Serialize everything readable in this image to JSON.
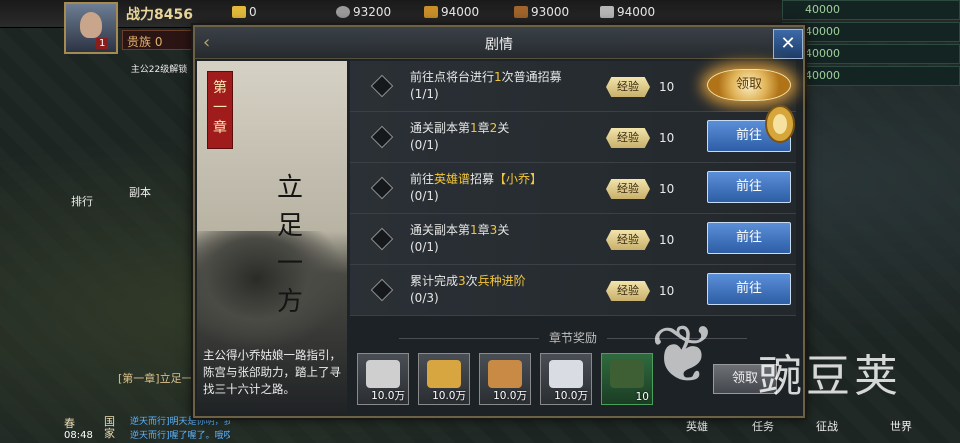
{
  "hud": {
    "power": "战力8456",
    "level": "1",
    "noble": "贵族  0",
    "resources": [
      {
        "name": "gold",
        "value": "0",
        "color": "#e2b93b"
      },
      {
        "name": "coin",
        "value": "93200",
        "color": "#9c9c9c"
      },
      {
        "name": "grain",
        "value": "94000",
        "color": "#c98f2a"
      },
      {
        "name": "wood",
        "value": "93000",
        "color": "#a0642c"
      },
      {
        "name": "iron",
        "value": "94000",
        "color": "#b7b7b7"
      }
    ],
    "right_stats": [
      "40000",
      "40000",
      "40000",
      "40000"
    ],
    "left_menu": [
      "主公22级解锁",
      "副本",
      "排行"
    ],
    "bottom": {
      "chapter_hint": "[第一章]立足一",
      "season": "春",
      "time": "08:48",
      "country": "国家",
      "chat": [
        "逆天而行]明天是你明，我大我天的",
        "逆天而行]喔了喔了。哦哎"
      ],
      "buttons": [
        "英雄",
        "任务",
        "征战",
        "世界"
      ]
    }
  },
  "dialog": {
    "title": "剧情",
    "chapter": {
      "tag": "第一章",
      "title": "立足一方",
      "description": "主公得小乔姑娘一路指引，陈宫与张郃助力，踏上了寻找三十六计之路。"
    },
    "quests": [
      {
        "title_parts": [
          [
            "前往点将台进行",
            ""
          ],
          [
            "1",
            "hl"
          ],
          [
            "次普通招募",
            ""
          ]
        ],
        "progress": "(1/1)",
        "exp_label": "经验",
        "exp": "10",
        "button": "领取",
        "state": "claim"
      },
      {
        "title_parts": [
          [
            "通关副本第",
            ""
          ],
          [
            "1",
            "hl"
          ],
          [
            "章",
            ""
          ],
          [
            "2",
            "hl"
          ],
          [
            "关",
            ""
          ]
        ],
        "progress": "(0/1)",
        "exp_label": "经验",
        "exp": "10",
        "button": "前往",
        "state": "goto"
      },
      {
        "title_parts": [
          [
            "前往",
            ""
          ],
          [
            "英雄谱",
            "hl"
          ],
          [
            "招募",
            ""
          ],
          [
            "【小乔】",
            "hl"
          ]
        ],
        "progress": "(0/1)",
        "exp_label": "经验",
        "exp": "10",
        "button": "前往",
        "state": "goto"
      },
      {
        "title_parts": [
          [
            "通关副本第",
            ""
          ],
          [
            "1",
            "hl"
          ],
          [
            "章",
            ""
          ],
          [
            "3",
            "hl"
          ],
          [
            "关",
            ""
          ]
        ],
        "progress": "(0/1)",
        "exp_label": "经验",
        "exp": "10",
        "button": "前往",
        "state": "goto"
      },
      {
        "title_parts": [
          [
            "累计完成",
            ""
          ],
          [
            "3",
            "hl"
          ],
          [
            "次",
            ""
          ],
          [
            "兵种进阶",
            "hl"
          ]
        ],
        "progress": "(0/3)",
        "exp_label": "经验",
        "exp": "10",
        "button": "前往",
        "state": "goto"
      }
    ],
    "reward_label": "章节奖励",
    "rewards": [
      {
        "icon": "coin-icon",
        "amount": "10.0万",
        "color": "#cfcfcf"
      },
      {
        "icon": "grain-icon",
        "amount": "10.0万",
        "color": "#d7a640"
      },
      {
        "icon": "wood-icon",
        "amount": "10.0万",
        "color": "#c98a45"
      },
      {
        "icon": "iron-icon",
        "amount": "10.0万",
        "color": "#d9dde3"
      },
      {
        "icon": "scroll-icon",
        "amount": "10",
        "color": "#3e5e34"
      }
    ],
    "reward_button": "领取"
  },
  "watermark": "豌豆荚"
}
